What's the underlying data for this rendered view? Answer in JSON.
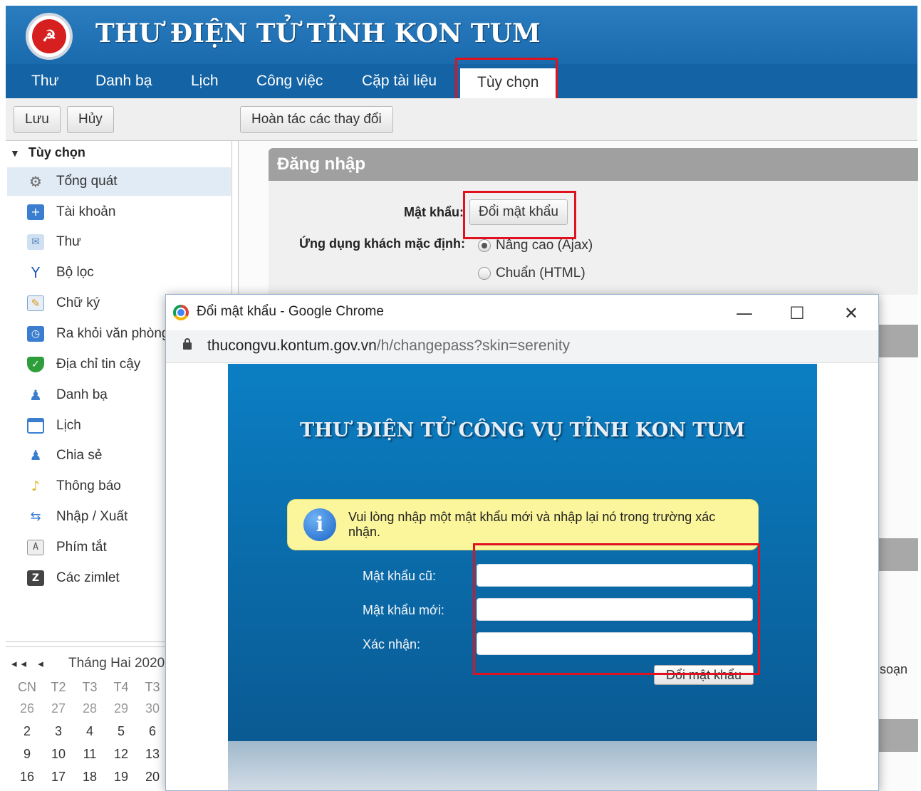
{
  "header": {
    "title": "THƯ ĐIỆN TỬ TỈNH KON TUM"
  },
  "nav": {
    "items": [
      "Thư",
      "Danh bạ",
      "Lịch",
      "Công việc",
      "Cặp tài liệu",
      "Tùy chọn"
    ],
    "active": "Tùy chọn"
  },
  "toolbar": {
    "save": "Lưu",
    "cancel": "Hủy",
    "revert": "Hoàn tác các thay đổi"
  },
  "sidebar": {
    "heading": "Tùy chọn",
    "items": [
      {
        "label": "Tổng quát",
        "icon": "gear-icon"
      },
      {
        "label": "Tài khoản",
        "icon": "account-icon"
      },
      {
        "label": "Thư",
        "icon": "envelope-icon"
      },
      {
        "label": "Bộ lọc",
        "icon": "filter-icon"
      },
      {
        "label": "Chữ ký",
        "icon": "signature-icon"
      },
      {
        "label": "Ra khỏi văn phòng",
        "icon": "out-of-office-icon"
      },
      {
        "label": "Địa chỉ tin cậy",
        "icon": "shield-icon"
      },
      {
        "label": "Danh bạ",
        "icon": "contact-icon"
      },
      {
        "label": "Lịch",
        "icon": "calendar-icon"
      },
      {
        "label": "Chia sẻ",
        "icon": "share-icon"
      },
      {
        "label": "Thông báo",
        "icon": "bell-icon"
      },
      {
        "label": "Nhập / Xuất",
        "icon": "import-export-icon"
      },
      {
        "label": "Phím tắt",
        "icon": "keyboard-icon"
      },
      {
        "label": "Các zimlet",
        "icon": "zimlet-icon"
      }
    ]
  },
  "calendar": {
    "nav": "◂◂ ◂",
    "title": "Tháng Hai 2020",
    "days_of_week": [
      "CN",
      "T2",
      "T3",
      "T4",
      "T3"
    ],
    "weeks": [
      [
        "26",
        "27",
        "28",
        "29",
        "30"
      ],
      [
        "2",
        "3",
        "4",
        "5",
        "6"
      ],
      [
        "9",
        "10",
        "11",
        "12",
        "13"
      ],
      [
        "16",
        "17",
        "18",
        "19",
        "20"
      ]
    ]
  },
  "login_section": {
    "title": "Đăng nhập",
    "password_label": "Mật khẩu:",
    "change_password_button": "Đổi mật khẩu",
    "default_client_label": "Ứng dụng khách mặc định:",
    "client_options": [
      "Nâng cao (Ajax)",
      "Chuẩn (HTML)"
    ],
    "selected_client": "Nâng cao (Ajax)",
    "partial_text": "soạn"
  },
  "popup": {
    "window_title": "Đổi mật khẩu - Google Chrome",
    "url_host": "thucongvu.kontum.gov.vn",
    "url_path": "/h/changepass?skin=serenity",
    "page_title": "THƯ ĐIỆN TỬ CÔNG VỤ TỈNH KON TUM",
    "info_message": "Vui lòng nhập một mật khẩu mới và nhập lại nó trong trường xác nhận.",
    "old_password_label": "Mật khẩu cũ:",
    "new_password_label": "Mật khẩu mới:",
    "confirm_label": "Xác nhận:",
    "submit_label": "Đổi mật khẩu"
  },
  "colors": {
    "header_blue": "#1a6aae",
    "highlight_red": "#e0121f",
    "info_yellow": "#fbf59b",
    "panel_blue": "#0a6aa8"
  }
}
